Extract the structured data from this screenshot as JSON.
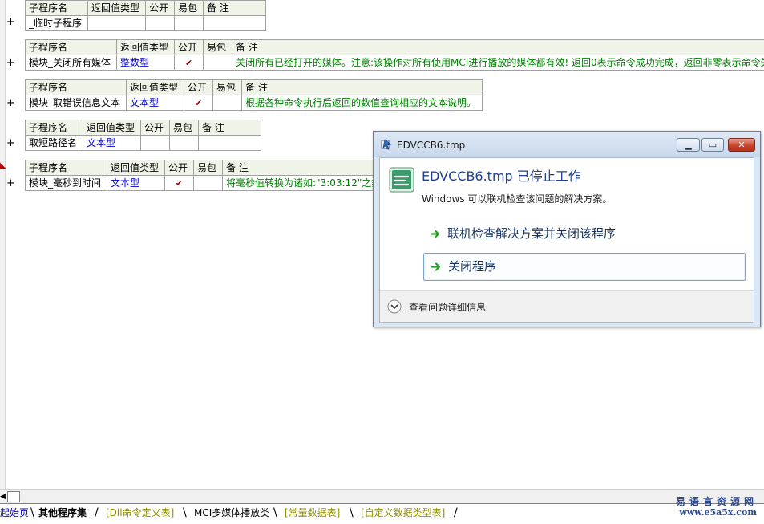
{
  "header_labels": {
    "name": "子程序名",
    "return_type": "返回值类型",
    "public": "公开",
    "easy_pack": "易包",
    "note": "备 注"
  },
  "subroutines": [
    {
      "name": "_临时子程序",
      "type": "",
      "public": false,
      "note": ""
    },
    {
      "name": "模块_关闭所有媒体",
      "type": "整数型",
      "public": true,
      "note": "关闭所有已经打开的媒体。注意:该操作对所有使用MCI进行播放的媒体都有效! 返回0表示命令成功完成，返回非零表示命令失"
    },
    {
      "name": "模块_取错误信息文本",
      "type": "文本型",
      "public": true,
      "note": "根据各种命令执行后返回的数值查询相应的文本说明。"
    },
    {
      "name": "取短路径名",
      "type": "文本型",
      "public": false,
      "note": ""
    },
    {
      "name": "模块_毫秒到时间",
      "type": "文本型",
      "public": true,
      "note": "将毫秒值转换为诸如:\"3:03:12\"之类"
    }
  ],
  "check_glyph": "✔",
  "expand_glyph": "+",
  "dialog": {
    "window_title": "EDVCCB6.tmp",
    "headline": "EDVCCB6.tmp 已停止工作",
    "subline": "Windows 可以联机检查该问题的解决方案。",
    "option_check_online": "联机检查解决方案并关闭该程序",
    "option_close": "关闭程序",
    "details_label": "查看问题详细信息"
  },
  "tabs": [
    "起始页",
    "其他程序集",
    "[Dll命令定义表]",
    "MCI多媒体播放类",
    "[常量数据表]",
    "[自定义数据类型表]"
  ],
  "watermark": {
    "line1": "易语言资源网",
    "line2": "www.e5a5x.com"
  }
}
